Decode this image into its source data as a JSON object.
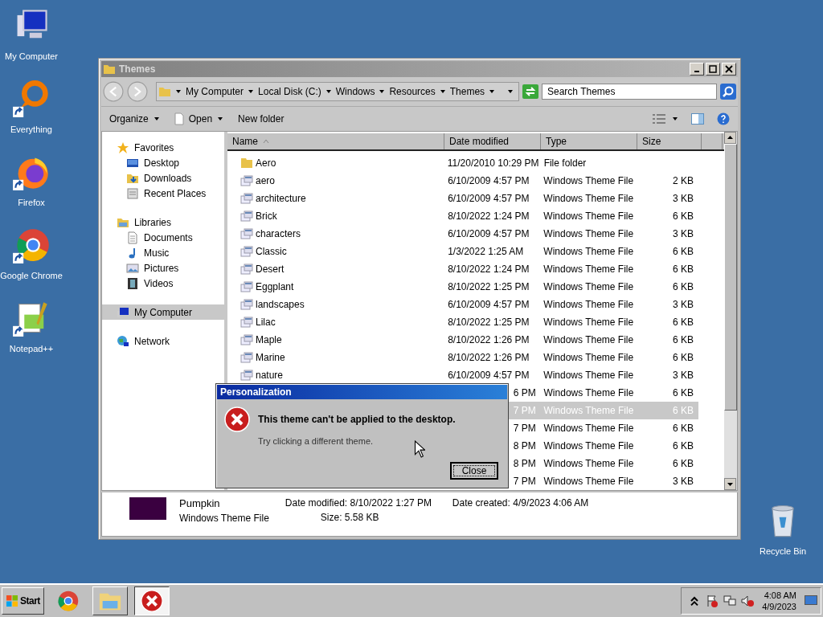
{
  "desktop_icons": [
    {
      "label": "My Computer",
      "kind": "computer",
      "shortcut": false
    },
    {
      "label": "Everything",
      "kind": "everything",
      "shortcut": true
    },
    {
      "label": "Firefox",
      "kind": "firefox",
      "shortcut": true
    },
    {
      "label": "Google Chrome",
      "kind": "chrome",
      "shortcut": true
    },
    {
      "label": "Notepad++",
      "kind": "notepad",
      "shortcut": true
    }
  ],
  "recycle_bin": {
    "label": "Recycle Bin"
  },
  "explorer": {
    "title": "Themes",
    "breadcrumb": [
      "My Computer",
      "Local Disk (C:)",
      "Windows",
      "Resources",
      "Themes"
    ],
    "search": {
      "placeholder": "Search Themes"
    },
    "toolbar": [
      {
        "label": "Organize",
        "kind": "plain",
        "dropdown": true
      },
      {
        "label": "Open",
        "kind": "file",
        "dropdown": true
      },
      {
        "label": "New folder",
        "kind": "plain",
        "dropdown": false
      }
    ],
    "nav": [
      {
        "label": "Favorites",
        "kind": "star",
        "selected": false,
        "children": [
          {
            "label": "Desktop",
            "kind": "desktop",
            "selected": false
          },
          {
            "label": "Downloads",
            "kind": "downloads",
            "selected": false
          },
          {
            "label": "Recent Places",
            "kind": "recent",
            "selected": false
          }
        ]
      },
      {
        "label": "Libraries",
        "kind": "library",
        "selected": false,
        "children": [
          {
            "label": "Documents",
            "kind": "documents",
            "selected": false
          },
          {
            "label": "Music",
            "kind": "music",
            "selected": false
          },
          {
            "label": "Pictures",
            "kind": "pictures",
            "selected": false
          },
          {
            "label": "Videos",
            "kind": "videos",
            "selected": false
          }
        ]
      },
      {
        "label": "My Computer",
        "kind": "computer",
        "selected": true
      },
      {
        "label": "Network",
        "kind": "network",
        "selected": false
      }
    ],
    "columns": [
      "Name",
      "Date modified",
      "Type",
      "Size"
    ],
    "rows": [
      {
        "kind": "folder",
        "name": "Aero",
        "date": "11/20/2010 10:29 PM",
        "type": "File folder",
        "selected": false,
        "covered": false
      },
      {
        "kind": "theme",
        "name": "aero",
        "date": "6/10/2009 4:57 PM",
        "type": "Windows Theme File",
        "size": "2 KB",
        "selected": false,
        "covered": false
      },
      {
        "kind": "theme",
        "name": "architecture",
        "date": "6/10/2009 4:57 PM",
        "type": "Windows Theme File",
        "size": "3 KB",
        "selected": false,
        "covered": false
      },
      {
        "kind": "theme",
        "name": "Brick",
        "date": "8/10/2022 1:24 PM",
        "type": "Windows Theme File",
        "size": "6 KB",
        "selected": false,
        "covered": false
      },
      {
        "kind": "theme",
        "name": "characters",
        "date": "6/10/2009 4:57 PM",
        "type": "Windows Theme File",
        "size": "3 KB",
        "selected": false,
        "covered": false
      },
      {
        "kind": "theme",
        "name": "Classic",
        "date": "1/3/2022 1:25 AM",
        "type": "Windows Theme File",
        "size": "6 KB",
        "selected": false,
        "covered": false
      },
      {
        "kind": "theme",
        "name": "Desert",
        "date": "8/10/2022 1:24 PM",
        "type": "Windows Theme File",
        "size": "6 KB",
        "selected": false,
        "covered": false
      },
      {
        "kind": "theme",
        "name": "Eggplant",
        "date": "8/10/2022 1:25 PM",
        "type": "Windows Theme File",
        "size": "6 KB",
        "selected": false,
        "covered": false
      },
      {
        "kind": "theme",
        "name": "landscapes",
        "date": "6/10/2009 4:57 PM",
        "type": "Windows Theme File",
        "size": "3 KB",
        "selected": false,
        "covered": false
      },
      {
        "kind": "theme",
        "name": "Lilac",
        "date": "8/10/2022 1:25 PM",
        "type": "Windows Theme File",
        "size": "6 KB",
        "selected": false,
        "covered": false
      },
      {
        "kind": "theme",
        "name": "Maple",
        "date": "8/10/2022 1:26 PM",
        "type": "Windows Theme File",
        "size": "6 KB",
        "selected": false,
        "covered": false
      },
      {
        "kind": "theme",
        "name": "Marine",
        "date": "8/10/2022 1:26 PM",
        "type": "Windows Theme File",
        "size": "6 KB",
        "selected": false,
        "covered": false
      },
      {
        "kind": "theme",
        "name": "nature",
        "date": "6/10/2009 4:57 PM",
        "type": "Windows Theme File",
        "size": "3 KB",
        "selected": false,
        "covered": false
      },
      {
        "date": "6 PM",
        "type": "Windows Theme File",
        "size": "6 KB",
        "selected": false,
        "covered": true
      },
      {
        "date": "7 PM",
        "type": "Windows Theme File",
        "size": "6 KB",
        "selected": true,
        "covered": true
      },
      {
        "date": "7 PM",
        "type": "Windows Theme File",
        "size": "6 KB",
        "selected": false,
        "covered": true
      },
      {
        "date": "8 PM",
        "type": "Windows Theme File",
        "size": "6 KB",
        "selected": false,
        "covered": true
      },
      {
        "date": "8 PM",
        "type": "Windows Theme File",
        "size": "6 KB",
        "selected": false,
        "covered": true
      },
      {
        "date": "7 PM",
        "type": "Windows Theme File",
        "size": "3 KB",
        "selected": false,
        "covered": true
      }
    ],
    "details": {
      "name": "Pumpkin",
      "type": "Windows Theme File",
      "color": "#3a0040",
      "fields": [
        {
          "label": "Date modified:",
          "value": "8/10/2022 1:27 PM"
        },
        {
          "label": "Date created:",
          "value": "4/9/2023 4:06 AM"
        },
        {
          "label": "Size:",
          "value": "5.58 KB"
        }
      ]
    }
  },
  "dialog": {
    "title": "Personalization",
    "message": "This theme can't be applied to the desktop.",
    "hint": "Try clicking a different theme.",
    "button": "Close"
  },
  "taskbar": {
    "start": "Start",
    "buttons": [
      {
        "kind": "chrome",
        "active": false
      },
      {
        "kind": "explorer",
        "active": false
      },
      {
        "kind": "error",
        "active": true
      }
    ],
    "tray": {
      "time": "4:08 AM",
      "date": "4/9/2023"
    }
  }
}
